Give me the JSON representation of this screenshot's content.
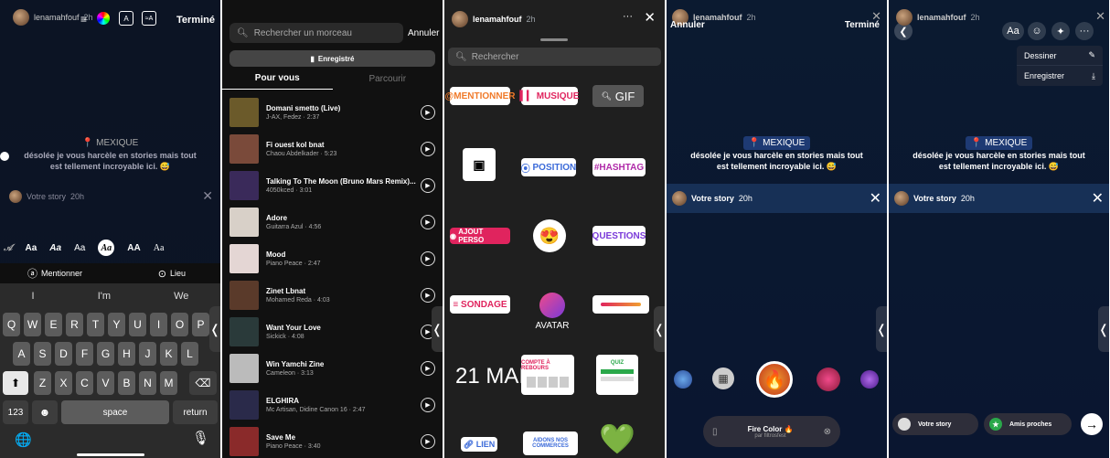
{
  "panel1": {
    "user": "lenamahfouf",
    "time": "2h",
    "done": "Terminé",
    "location": "MEXIQUE",
    "story_text_1": "désolée je vous harcèle en stories mais tout",
    "story_text_2": "est tellement incroyable ici. 😅",
    "reply_label": "Votre story",
    "reply_time": "20h",
    "fonts": [
      "Aa",
      "Aa",
      "Aa",
      "Aa",
      "AA",
      "Aa"
    ],
    "mention": "Mentionner",
    "place": "Lieu",
    "suggestions": [
      "I",
      "I'm",
      "We"
    ],
    "row1": [
      "Q",
      "W",
      "E",
      "R",
      "T",
      "Y",
      "U",
      "I",
      "O",
      "P"
    ],
    "row2": [
      "A",
      "S",
      "D",
      "F",
      "G",
      "H",
      "J",
      "K",
      "L"
    ],
    "row3": [
      "Z",
      "X",
      "C",
      "V",
      "B",
      "N",
      "M"
    ],
    "num": "123",
    "space": "space",
    "return": "return"
  },
  "panel2": {
    "search_placeholder": "Rechercher un morceau",
    "cancel": "Annuler",
    "saved": "Enregistré",
    "tab_for_you": "Pour vous",
    "tab_browse": "Parcourir",
    "songs": [
      {
        "title": "Domani smetto (Live)",
        "artist": "J-AX, Fedez · 2:37",
        "color": "#6b5a2a"
      },
      {
        "title": "Fi ouest kol bnat",
        "artist": "Chaou Abdelkader · 5:23",
        "color": "#7a4a3a"
      },
      {
        "title": "Talking To The Moon (Bruno Mars Remix)...",
        "artist": "4050kced · 3:01",
        "color": "#3a2a5a"
      },
      {
        "title": "Adore",
        "artist": "Guitarra Azul · 4:56",
        "color": "#d8d0c8"
      },
      {
        "title": "Mood",
        "artist": "Piano Peace · 2:47",
        "color": "#e4d6d4"
      },
      {
        "title": "Zinet Lbnat",
        "artist": "Mohamed Reda · 4:03",
        "color": "#5a3a2a"
      },
      {
        "title": "Want Your Love",
        "artist": "Sickick · 4:08",
        "color": "#2a3a3a"
      },
      {
        "title": "Win Yamchi Zine",
        "artist": "Cameleon · 3:13",
        "color": "#bbbbbb"
      },
      {
        "title": "ELGHIRA",
        "artist": "Mc Artisan, Didine Canon 16 · 2:47",
        "color": "#2a2a4a"
      },
      {
        "title": "Save Me",
        "artist": "Piano Peace · 3:40",
        "color": "#8a2a2a"
      }
    ]
  },
  "panel3": {
    "user": "lenamahfouf",
    "time": "2h",
    "search_placeholder": "Rechercher",
    "mention": "@MENTIONNER",
    "music": "MUSIQUE",
    "gif": "GIF",
    "position": "POSITION",
    "hashtag": "#HASHTAG",
    "custom": "AJOUT PERSO",
    "questions": "QUESTIONS",
    "poll": "SONDAGE",
    "avatar": "AVATAR",
    "date": "21 MAI",
    "countdown": "COMPTE À REBOURS",
    "quiz": "QUIZ",
    "link": "LIEN",
    "help1": "AIDONS NOS",
    "help2": "COMMERCES"
  },
  "panel4": {
    "user": "lenamahfouf",
    "time": "2h",
    "cancel": "Annuler",
    "done": "Terminé",
    "location": "MEXIQUE",
    "story_text_1": "désolée je vous harcèle en stories mais tout",
    "story_text_2": "est tellement incroyable ici. 😅",
    "reply_label": "Votre story",
    "reply_time": "20h",
    "effect_name": "Fire Color 🔥",
    "effect_by": "par filtrosfest"
  },
  "panel5": {
    "user": "lenamahfouf",
    "time": "2h",
    "text_tool": "Aa",
    "draw": "Dessiner",
    "save": "Enregistrer",
    "location": "MEXIQUE",
    "story_text_1": "désolée je vous harcèle en stories mais tout",
    "story_text_2": "est tellement incroyable ici. 😅",
    "reply_label": "Votre story",
    "reply_time": "20h",
    "your_story": "Votre story",
    "close_friends": "Amis proches"
  }
}
